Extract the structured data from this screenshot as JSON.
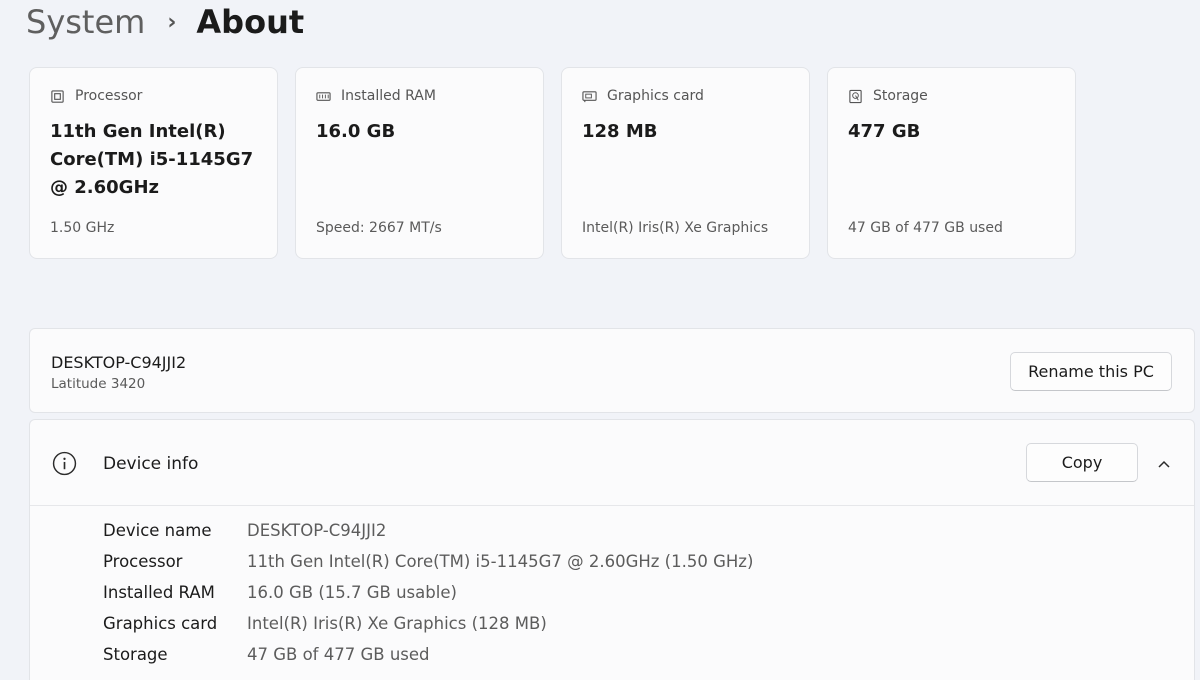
{
  "breadcrumb": {
    "parent": "System",
    "separator": "›",
    "current": "About"
  },
  "cards": [
    {
      "icon": "processor-icon",
      "label": "Processor",
      "value": "11th Gen Intel(R) Core(TM) i5-1145G7 @ 2.60GHz",
      "sub": "1.50 GHz"
    },
    {
      "icon": "ram-icon",
      "label": "Installed RAM",
      "value": "16.0 GB",
      "sub": "Speed: 2667 MT/s"
    },
    {
      "icon": "graphics-card-icon",
      "label": "Graphics card",
      "value": "128 MB",
      "sub": "Intel(R) Iris(R) Xe Graphics"
    },
    {
      "icon": "storage-icon",
      "label": "Storage",
      "value": "477 GB",
      "sub": "47 GB of 477 GB used"
    }
  ],
  "pc": {
    "name": "DESKTOP-C94JJI2",
    "model": "Latitude 3420",
    "rename_label": "Rename this PC"
  },
  "device_info": {
    "title": "Device info",
    "copy_label": "Copy",
    "icon": "info-icon",
    "rows": [
      {
        "key": "Device name",
        "value": "DESKTOP-C94JJI2"
      },
      {
        "key": "Processor",
        "value": "11th Gen Intel(R) Core(TM) i5-1145G7 @ 2.60GHz (1.50 GHz)"
      },
      {
        "key": "Installed RAM",
        "value": "16.0 GB (15.7 GB usable)"
      },
      {
        "key": "Graphics card",
        "value": "Intel(R) Iris(R) Xe Graphics (128 MB)"
      },
      {
        "key": "Storage",
        "value": "47 GB of 477 GB used"
      }
    ]
  }
}
